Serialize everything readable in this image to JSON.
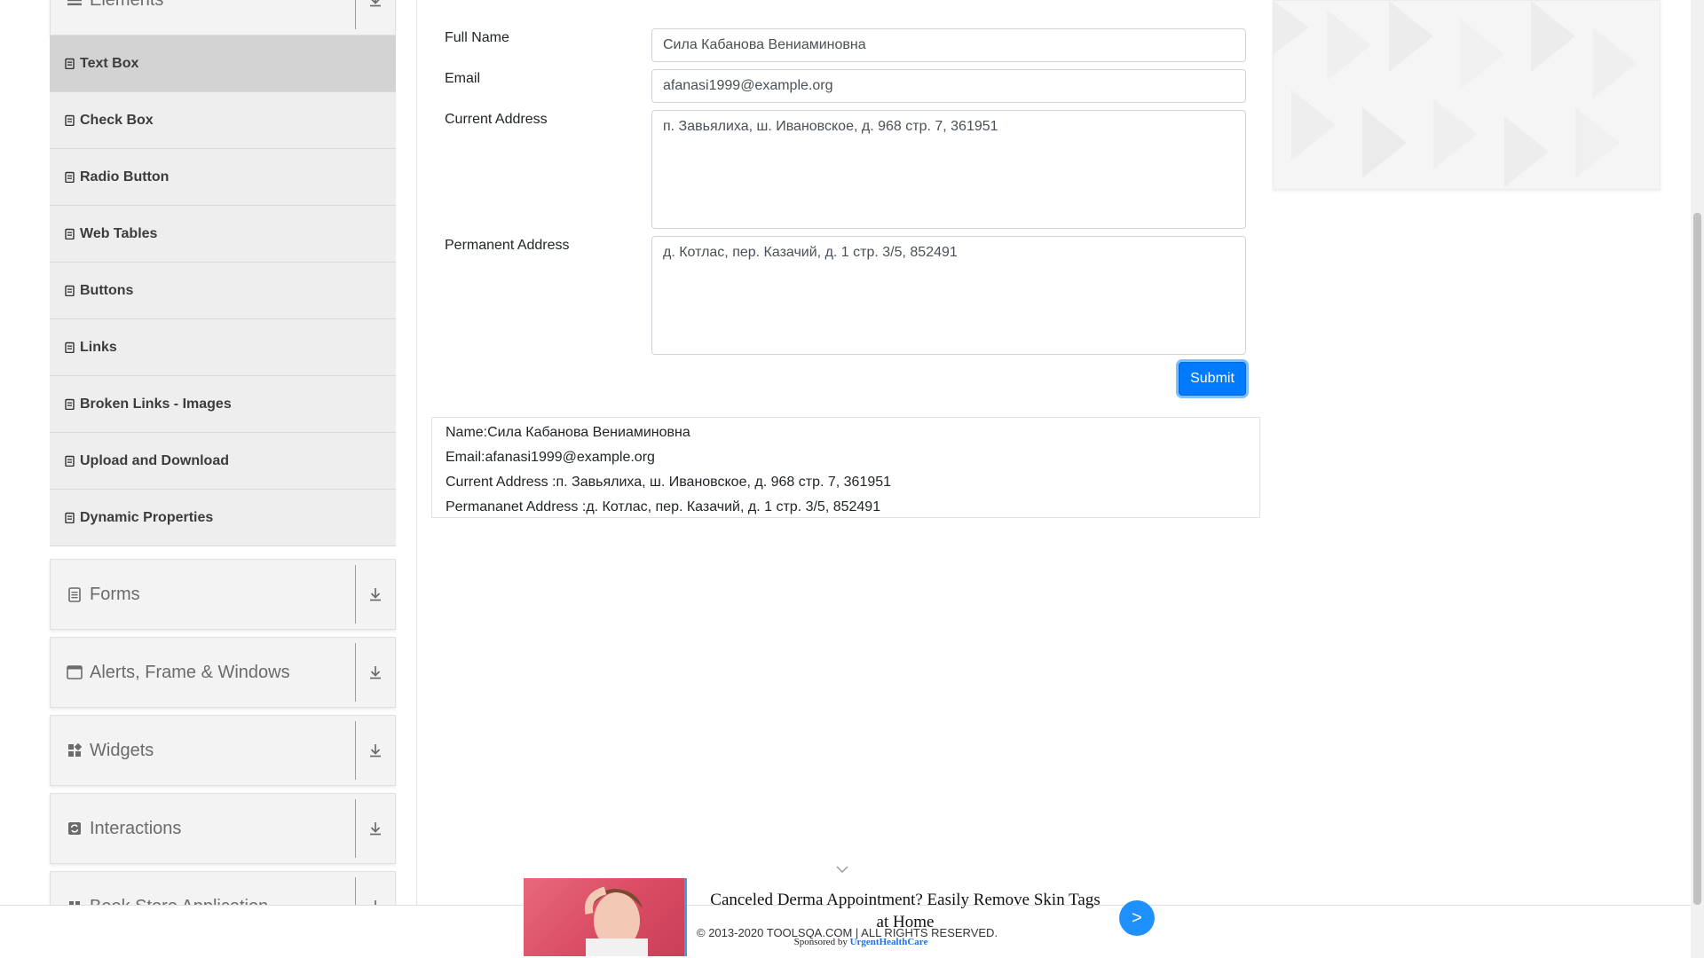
{
  "sidebar": {
    "top_group": {
      "title": "Elements",
      "icon": "menu-icon"
    },
    "items": [
      {
        "label": "Text Box",
        "active": true
      },
      {
        "label": "Check Box",
        "active": false
      },
      {
        "label": "Radio Button",
        "active": false
      },
      {
        "label": "Web Tables",
        "active": false
      },
      {
        "label": "Buttons",
        "active": false
      },
      {
        "label": "Links",
        "active": false
      },
      {
        "label": "Broken Links - Images",
        "active": false
      },
      {
        "label": "Upload and Download",
        "active": false
      },
      {
        "label": "Dynamic Properties",
        "active": false
      }
    ],
    "groups": [
      {
        "title": "Forms",
        "icon": "document-icon"
      },
      {
        "title": "Alerts, Frame & Windows",
        "icon": "window-icon"
      },
      {
        "title": "Widgets",
        "icon": "widgets-icon"
      },
      {
        "title": "Interactions",
        "icon": "interactions-icon"
      },
      {
        "title": "Book Store Application",
        "icon": "book-icon"
      }
    ]
  },
  "form": {
    "full_name": {
      "label": "Full Name",
      "value": "Сила Кабанова Вениаминовна"
    },
    "email": {
      "label": "Email",
      "value": "afanasi1999@example.org"
    },
    "current_address": {
      "label": "Current Address",
      "value": "п. Завьялиха, ш. Ивановское, д. 968 стр. 7, 361951"
    },
    "permanent_address": {
      "label": "Permanent Address",
      "value": "д. Котлас, пер. Казачий, д. 1 стр. 3/5, 852491"
    },
    "submit_label": "Submit"
  },
  "output": {
    "name": "Name:Сила Кабанова Вениаминовна",
    "email": "Email:afanasi1999@example.org",
    "current_address": "Current Address :п. Завьялиха, ш. Ивановское, д. 968 стр. 7, 361951",
    "permanent_address": "Permananet Address :д. Котлас, пер. Казачий, д. 1 стр. 3/5, 852491"
  },
  "footer": {
    "text": "© 2013-2020 TOOLSQA.COM | ALL RIGHTS RESERVED."
  },
  "ad": {
    "headline": "Canceled Derma Appointment? Easily Remove Skin Tags at Home",
    "sponsored_prefix": "Sponsored by",
    "sponsor": "UrgentHealthCare",
    "go_label": ">"
  },
  "colors": {
    "accent": "#007bff",
    "sidebar_bg": "#eeeeee",
    "active_item": "#d3d3d3"
  }
}
